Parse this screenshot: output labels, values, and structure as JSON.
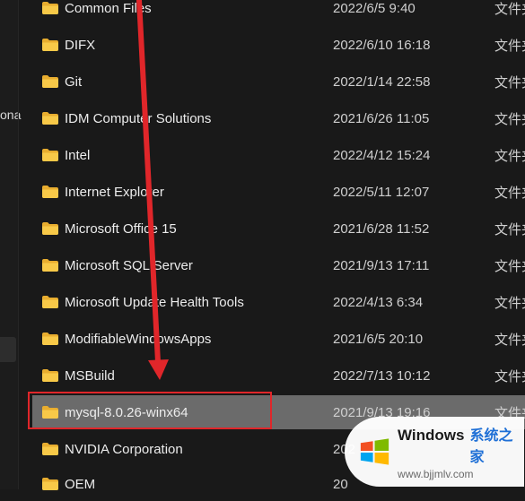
{
  "left_pane": {
    "cut_text": "ona"
  },
  "files": [
    {
      "name": "Common Files",
      "date": "2022/6/5 9:40",
      "type": "文件夹"
    },
    {
      "name": "DIFX",
      "date": "2022/6/10 16:18",
      "type": "文件夹"
    },
    {
      "name": "Git",
      "date": "2022/1/14 22:58",
      "type": "文件夹"
    },
    {
      "name": "IDM Computer Solutions",
      "date": "2021/6/26 11:05",
      "type": "文件夹"
    },
    {
      "name": "Intel",
      "date": "2022/4/12 15:24",
      "type": "文件夹"
    },
    {
      "name": "Internet Explorer",
      "date": "2022/5/11 12:07",
      "type": "文件夹"
    },
    {
      "name": "Microsoft Office 15",
      "date": "2021/6/28 11:52",
      "type": "文件夹"
    },
    {
      "name": "Microsoft SQL Server",
      "date": "2021/9/13 17:11",
      "type": "文件夹"
    },
    {
      "name": "Microsoft Update Health Tools",
      "date": "2022/4/13 6:34",
      "type": "文件夹"
    },
    {
      "name": "ModifiableWindowsApps",
      "date": "2021/6/5 20:10",
      "type": "文件夹"
    },
    {
      "name": "MSBuild",
      "date": "2022/7/13 10:12",
      "type": "文件夹"
    },
    {
      "name": "mysql-8.0.26-winx64",
      "date": "2021/9/13 19:16",
      "type": "文件夹",
      "selected": true
    },
    {
      "name": "NVIDIA Corporation",
      "date": "202",
      "type": ""
    },
    {
      "name": "OEM",
      "date": "20",
      "type": ""
    }
  ],
  "colors": {
    "folder": "#f6c445",
    "selection": "#6b6b6b",
    "highlight_box": "#e0262a",
    "arrow": "#e0262a"
  },
  "icons": {
    "folder": "folder-icon"
  },
  "watermark": {
    "brand": "Windows",
    "cn": "系统之家",
    "url": "www.bjjmlv.com"
  }
}
